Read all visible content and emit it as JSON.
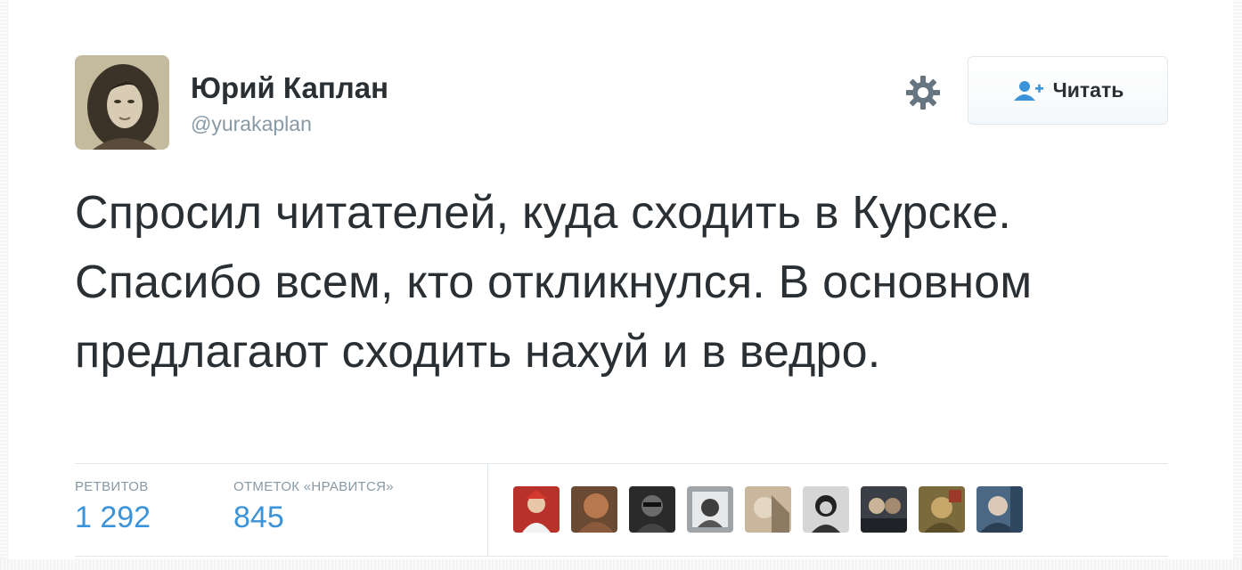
{
  "author": {
    "name": "Юрий Каплан",
    "handle": "@yurakaplan",
    "avatar_icon": "user-avatar-portrait"
  },
  "actions": {
    "settings_icon": "gear-icon",
    "follow_label": "Читать",
    "follow_icon": "add-person-icon",
    "accent_color": "#3b94d9"
  },
  "tweet": {
    "text": "Спросил читателей, куда сходить в Курске. Спасибо всем, кто откликнулся. В основном предлагают сходить нахуй и в ведро."
  },
  "stats": {
    "retweets_label": "РЕТВИТОВ",
    "retweets_value": "1 292",
    "likes_label": "ОТМЕТОК «НРАВИТСЯ»",
    "likes_value": "845"
  },
  "likers": [
    {
      "icon": "liker-avatar-1"
    },
    {
      "icon": "liker-avatar-2"
    },
    {
      "icon": "liker-avatar-3"
    },
    {
      "icon": "liker-avatar-4"
    },
    {
      "icon": "liker-avatar-5"
    },
    {
      "icon": "liker-avatar-6"
    },
    {
      "icon": "liker-avatar-7"
    },
    {
      "icon": "liker-avatar-8"
    },
    {
      "icon": "liker-avatar-9"
    }
  ]
}
